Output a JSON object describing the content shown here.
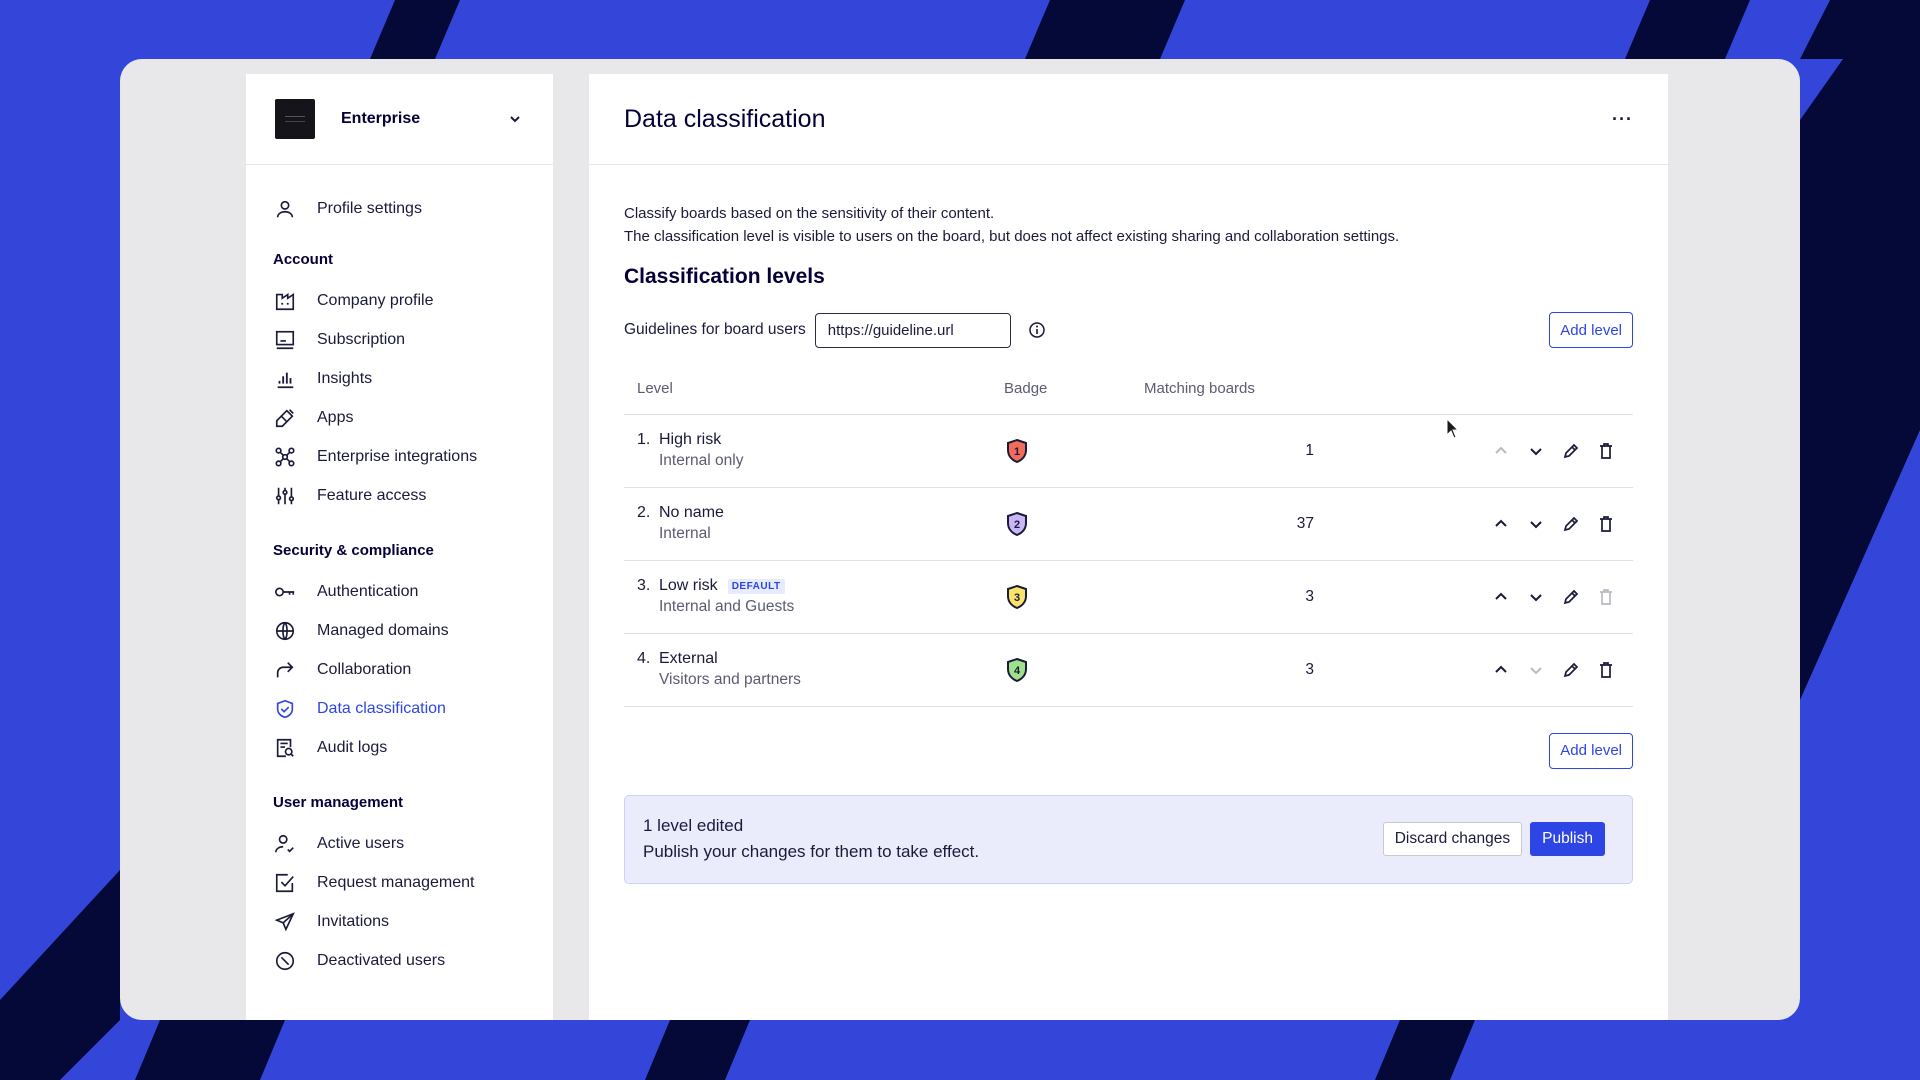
{
  "colors": {
    "accent": "#2e45e6",
    "background": "#3346d9",
    "stripe": "#050938"
  },
  "org": {
    "name": "Enterprise",
    "logo_icon": "org-logo"
  },
  "sidebar": {
    "top_item": {
      "label": "Profile settings",
      "icon": "person-icon"
    },
    "sections": [
      {
        "title": "Account",
        "items": [
          {
            "label": "Company profile",
            "icon": "building-icon"
          },
          {
            "label": "Subscription",
            "icon": "card-icon"
          },
          {
            "label": "Insights",
            "icon": "chart-icon"
          },
          {
            "label": "Apps",
            "icon": "plug-icon"
          },
          {
            "label": "Enterprise integrations",
            "icon": "network-icon"
          },
          {
            "label": "Feature access",
            "icon": "sliders-icon"
          }
        ]
      },
      {
        "title": "Security & compliance",
        "items": [
          {
            "label": "Authentication",
            "icon": "key-icon"
          },
          {
            "label": "Managed domains",
            "icon": "globe-icon"
          },
          {
            "label": "Collaboration",
            "icon": "share-arrow-icon"
          },
          {
            "label": "Data classification",
            "icon": "shield-check-icon",
            "active": true
          },
          {
            "label": "Audit logs",
            "icon": "audit-log-icon"
          }
        ]
      },
      {
        "title": "User management",
        "items": [
          {
            "label": "Active users",
            "icon": "user-check-icon"
          },
          {
            "label": "Request management",
            "icon": "checkbox-icon"
          },
          {
            "label": "Invitations",
            "icon": "send-icon"
          },
          {
            "label": "Deactivated users",
            "icon": "deactivated-icon"
          }
        ]
      }
    ]
  },
  "main": {
    "title": "Data classification",
    "more_label": "···",
    "description_line1": "Classify boards based on the sensitivity of their content.",
    "description_line2": "The classification level is visible to users on the board, but does not affect existing sharing and collaboration settings.",
    "section_title": "Classification levels",
    "guidelines_label": "Guidelines for board users",
    "guidelines_value": "https://guideline.url",
    "add_level_label": "Add level",
    "table": {
      "headers": {
        "level": "Level",
        "badge": "Badge",
        "matching": "Matching boards"
      },
      "rows": [
        {
          "num": "1.",
          "name": "High risk",
          "sub": "Internal only",
          "badge": "1",
          "badge_color": "#f26b5b",
          "count": "1",
          "default": false,
          "up_disabled": true,
          "down_disabled": false,
          "delete_disabled": false
        },
        {
          "num": "2.",
          "name": "No name",
          "sub": "Internal",
          "badge": "2",
          "badge_color": "#c9b6f5",
          "count": "37",
          "default": false,
          "up_disabled": false,
          "down_disabled": false,
          "delete_disabled": false
        },
        {
          "num": "3.",
          "name": "Low risk",
          "sub": "Internal and Guests",
          "badge": "3",
          "badge_color": "#f9e36a",
          "count": "3",
          "default": true,
          "default_label": "DEFAULT",
          "up_disabled": false,
          "down_disabled": false,
          "delete_disabled": true
        },
        {
          "num": "4.",
          "name": "External",
          "sub": "Visitors and partners",
          "badge": "4",
          "badge_color": "#9fe08a",
          "count": "3",
          "default": false,
          "up_disabled": false,
          "down_disabled": true,
          "delete_disabled": false
        }
      ]
    },
    "notice": {
      "line1": "1 level edited",
      "line2": "Publish your changes for them to take effect.",
      "discard_label": "Discard changes",
      "publish_label": "Publish"
    }
  }
}
